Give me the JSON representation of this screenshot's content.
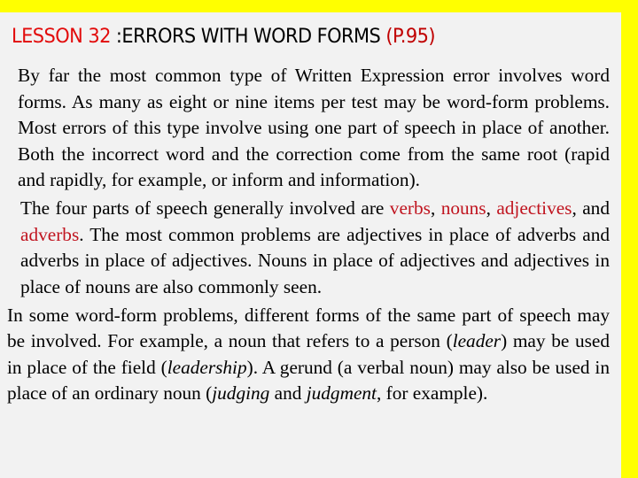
{
  "colors": {
    "frame": "#ffff00",
    "panel": "#f2f2f2",
    "lesson_red": "#e20b0b",
    "page_red": "#c00000",
    "highlight_red": "#c0141f"
  },
  "title": {
    "lesson": "LESSON 32",
    "topic": " :ERRORS WITH WORD FORMS ",
    "page": "(P.95)"
  },
  "paragraphs": {
    "p1": "By far the most common type of Written Expression error involves word forms. As many as eight or nine items per test may be word-form problems. Most errors of this type involve using one part of speech in place of another. Both the incorrect word and the correction come from the same root (rapid and rapidly, for example, or inform and information).",
    "p2": {
      "intro": "The four parts of speech generally involved are ",
      "w1": "verbs",
      "sep1": ", ",
      "w2": "nouns",
      "sep2": ", ",
      "w3": "adjectives",
      "sep3": ", and ",
      "w4": "adverbs",
      "rest": ". The most common problems are adjectives in place of adverbs and adverbs in place of adjectives. Nouns in place of adjectives and adjectives in place of nouns are also commonly seen."
    },
    "p3": {
      "a": "In some word-form problems, different forms of the same part of speech may be involved. For example, a noun that refers to a person (",
      "i1": "leader",
      "b": ") may be used in place of the field (",
      "i2": "leadership",
      "c": "). A gerund (a verbal noun) may also be used in place of an ordinary noun (",
      "i3": "judging",
      "d": " and ",
      "i4": "judgment",
      "e": ", for example)."
    }
  }
}
